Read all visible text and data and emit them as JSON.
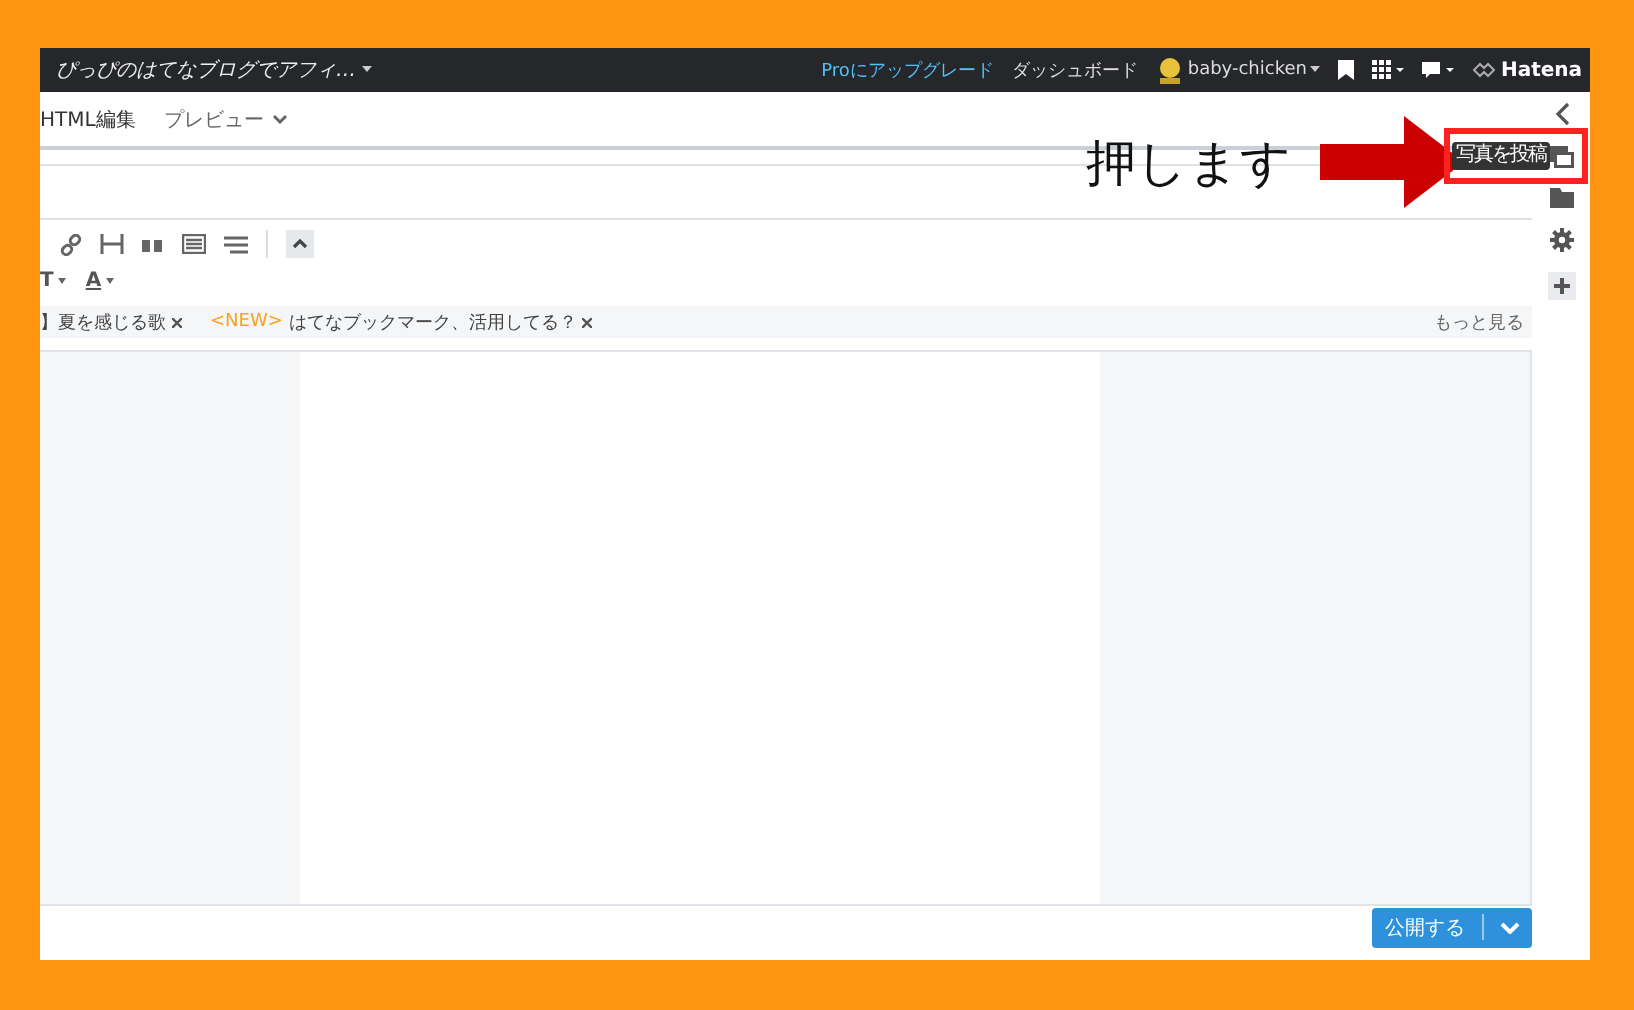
{
  "topbar": {
    "blog_title": "ぴっぴのはてなブログでアフィ…",
    "links": [
      {
        "label": "Proにアップグレード",
        "kind": "pro"
      },
      {
        "label": "ダッシュボード",
        "kind": "plain"
      }
    ],
    "user": "baby-chicken",
    "brand": "Hatena"
  },
  "editor_tabs": [
    {
      "label": "HTML編集",
      "selected": true
    },
    {
      "label": "プレビュー",
      "selected": false
    }
  ],
  "format_buttons": [
    "T",
    "A"
  ],
  "suggestions": [
    {
      "label": "】夏を感じる歌"
    },
    {
      "tag": "<NEW>",
      "label": "はてなブックマーク、活用してる？"
    }
  ],
  "more_link": "もっと見る",
  "sidebar": {
    "tooltip": "写真を投稿"
  },
  "publish_button": "公開する",
  "annotation": {
    "text": "押します"
  }
}
